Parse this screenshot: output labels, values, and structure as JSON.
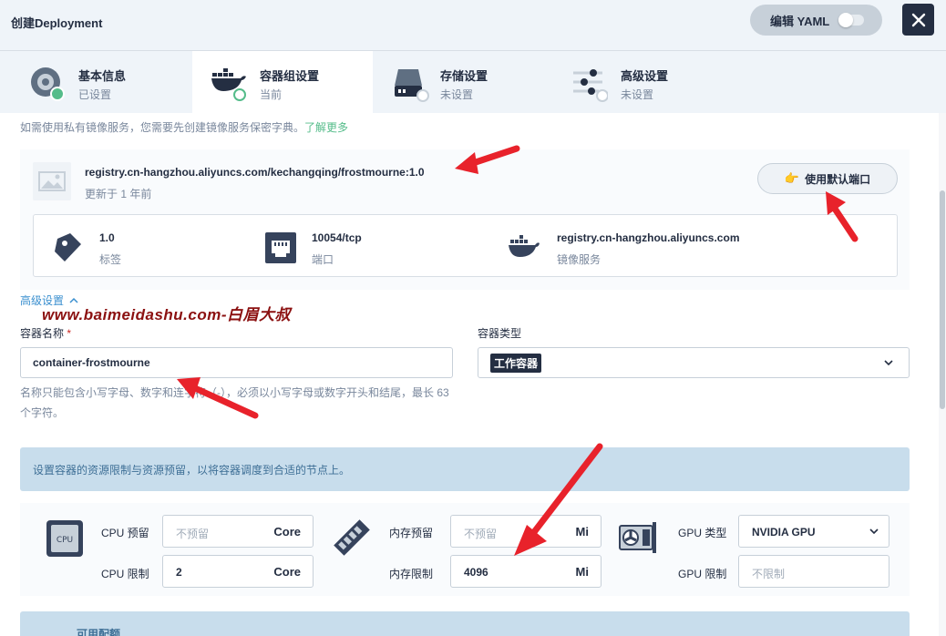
{
  "header": {
    "title": "创建Deployment",
    "yaml_label": "编辑 YAML"
  },
  "steps": [
    {
      "title": "基本信息",
      "status": "已设置"
    },
    {
      "title": "容器组设置",
      "status": "当前"
    },
    {
      "title": "存储设置",
      "status": "未设置"
    },
    {
      "title": "高级设置",
      "status": "未设置"
    }
  ],
  "hint": {
    "text": "如需使用私有镜像服务，您需要先创建镜像服务保密字典。",
    "link": "了解更多"
  },
  "image": {
    "name": "registry.cn-hangzhou.aliyuncs.com/kechangqing/frostmourne:1.0",
    "updated": "更新于 1 年前",
    "port_button": "使用默认端口",
    "tag_value": "1.0",
    "tag_label": "标签",
    "port_value": "10054/tcp",
    "port_label": "端口",
    "registry_value": "registry.cn-hangzhou.aliyuncs.com",
    "registry_label": "镜像服务"
  },
  "advanced_toggle": "高级设置",
  "watermark": "www.baimeidashu.com-白眉大叔",
  "container": {
    "name_label": "容器名称",
    "required_mark": "*",
    "name_value": "container-frostmourne",
    "type_label": "容器类型",
    "type_value": "工作容器",
    "help_text": "名称只能包含小写字母、数字和连字符（-），必须以小写字母或数字开头和结尾，最长 63 个字符。"
  },
  "resource_notice": "设置容器的资源限制与资源预留，以将容器调度到合适的节点上。",
  "resources": {
    "cpu_icon_label": "CPU",
    "cpu_request_label": "CPU 预留",
    "cpu_request_placeholder": "不预留",
    "cpu_unit": "Core",
    "cpu_limit_label": "CPU 限制",
    "cpu_limit_value": "2",
    "mem_request_label": "内存预留",
    "mem_request_placeholder": "不预留",
    "mem_unit": "Mi",
    "mem_limit_label": "内存限制",
    "mem_limit_value": "4096",
    "gpu_type_label": "GPU 类型",
    "gpu_type_value": "NVIDIA GPU",
    "gpu_limit_label": "GPU 限制",
    "gpu_limit_placeholder": "不限制"
  },
  "quota_title": "可用配额",
  "colors": {
    "dark": "#242e42",
    "green": "#55bc8a",
    "annotation_red": "#e8222b",
    "notice_bg": "#c8ddec"
  }
}
